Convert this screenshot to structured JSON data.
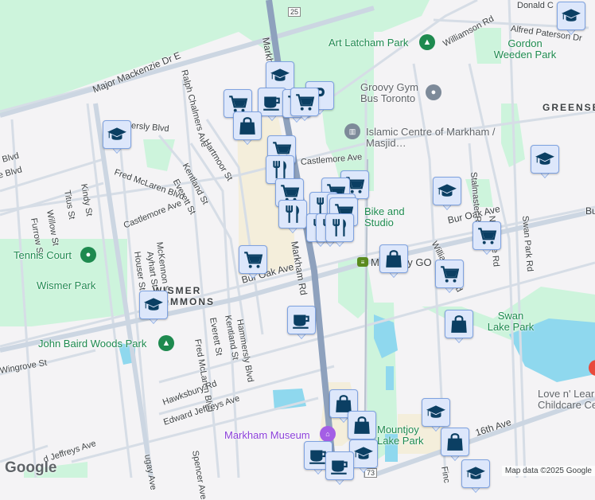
{
  "map": {
    "streets": {
      "major_mackenzie": "Major Mackenzie Dr E",
      "markham_rd_top": "Markham",
      "markham_rd": "Markham Rd",
      "ralph_chalmers": "Ralph Chalmers Ave",
      "hartmoor": "Hartmoor St",
      "hammersly_top": "ersly Blvd",
      "kentland_top": "Kentland St",
      "everett_top": "Everett St",
      "fred_mclaren_top": "Fred McLaren Blvd",
      "castlemore_w": "Castlemore Ave",
      "castlemore_e": "Castlemore Ave",
      "kindy": "Kindy St",
      "titus": "Titus St",
      "willow": "Willow St",
      "furrow": "Furrow St",
      "blvd1": "Blvd",
      "blvd2": "e Blvd",
      "mckennon": "McKennon St",
      "ayhart": "Ayhart St",
      "houser": "Houser St",
      "bur_oak_w": "Bur Oak Ave",
      "bur_oak_e": "Bur Oak Ave",
      "bur_oak_far": "Bu",
      "fred_mclaren_s": "Fred McLaren Blvd",
      "everett_s": "Everett St",
      "kentland_s": "Kentland St",
      "hammersly_s": "Hammersly Blvd",
      "wingrove": "Wingrove St",
      "hawksbury": "Hawksbury Rd",
      "edward_jeffreys": "Edward Jeffreys Ave",
      "edward_jeffreys_w": "d Jeffreys Ave",
      "spencer": "Spencer Ave",
      "roughgay": "ugay Ave",
      "williamson": "Williamson Rd",
      "williamson_s": "Williamson Rd",
      "alfred_paterson": "Alfred Paterson Dr",
      "donald": "Donald C",
      "stalmaster": "Stalmaster Rd",
      "swan_park": "Swan Park Rd",
      "northside": "Northside Rd",
      "sixteenth": "16th Ave",
      "finch": "Finc",
      "route_25": "25",
      "route_73": "73"
    },
    "places": {
      "art_latcham": "Art Latcham Park",
      "gordon_weeden": "Gordon Weeden Park",
      "groovy_gym": "Groovy Gym Bus Toronto",
      "islamic_centre": "Islamic Centre of Markham / Masjid…",
      "greensborough": "GREENSB",
      "bike_studio": "Bike and Studio",
      "mountjoy_go": "Mountjoy GO",
      "tennis_court": "Tennis Court",
      "wismer_park": "Wismer Park",
      "wismer_commons": "WISMER COMMONS",
      "john_baird": "John Baird Woods Park",
      "swan_lake": "Swan Lake Park",
      "love_n_learn": "Love n' Learn Childcare Centre",
      "markham_museum": "Markham Museum",
      "mountjoy_lake": "Mountjoy Lake Park"
    },
    "markers": [
      "school",
      "grocery",
      "cafe",
      "grocery",
      "parking",
      "grocery",
      "shopping",
      "school",
      "grocery",
      "restaurant",
      "grocery",
      "grocery",
      "grocery",
      "restaurant",
      "grocery",
      "restaurant",
      "restaurant",
      "grocery",
      "restaurant",
      "restaurant",
      "school",
      "school",
      "school",
      "grocery",
      "grocery",
      "shopping",
      "grocery",
      "school",
      "cafe",
      "shopping",
      "shopping",
      "shopping",
      "school",
      "shopping",
      "school",
      "cafe",
      "cafe",
      "school"
    ],
    "colors": {
      "park": "#cdf4dc",
      "water": "#8fd8ee",
      "road": "#ccd6e2",
      "highway": "#8ea1bd",
      "commercial": "#f4eedb",
      "marker_bg": "#dde7fb",
      "marker_icon": "#0b3f63"
    }
  },
  "branding": {
    "logo": "Google",
    "attribution": "Map data ©2025 Google"
  }
}
